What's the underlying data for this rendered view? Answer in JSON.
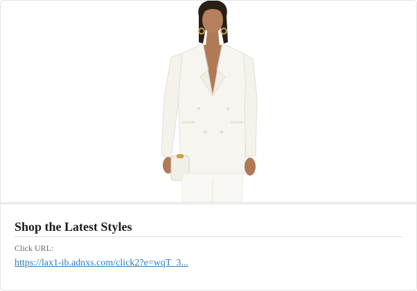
{
  "card": {
    "image_alt": "Model wearing white double-breasted blazer",
    "title": "Shop the Latest Styles",
    "click_url_label": "Click URL:",
    "click_url_text": "https://lax1-ib.adnxs.com/click2?e=wqT_3..."
  },
  "colors": {
    "link": "#2a7ab8",
    "title": "#1a1a1a",
    "label": "#666666",
    "blazer": "#f7f5ef"
  }
}
